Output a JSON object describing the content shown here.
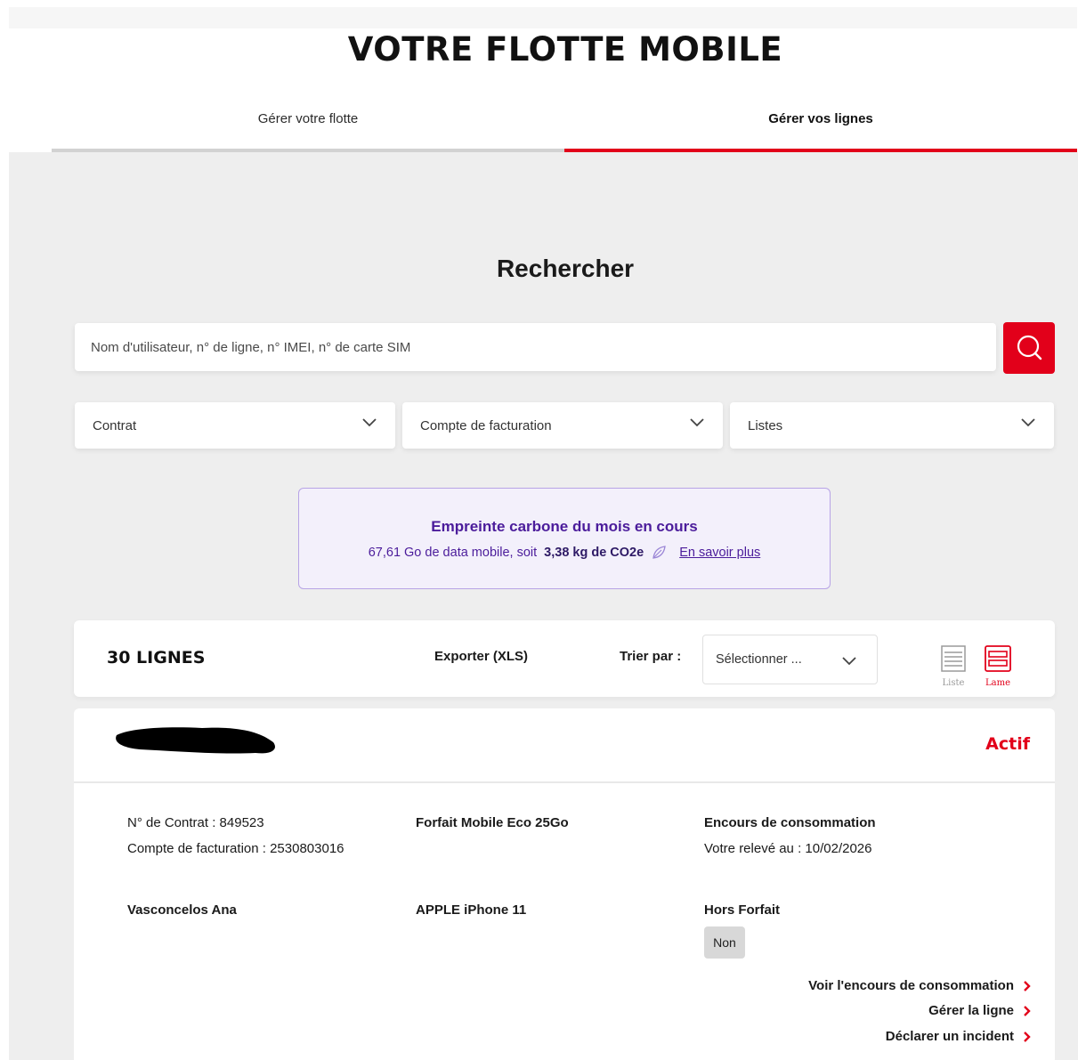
{
  "page": {
    "title": "VOTRE FLOTTE MOBILE"
  },
  "tabs": [
    {
      "label": "Gérer votre flotte",
      "active": false
    },
    {
      "label": "Gérer vos lignes",
      "active": true
    }
  ],
  "search": {
    "title": "Rechercher",
    "placeholder": "Nom d'utilisateur, n° de ligne, n° IMEI, n° de carte SIM",
    "button_icon": "search-icon"
  },
  "filters": [
    {
      "label": "Contrat"
    },
    {
      "label": "Compte de facturation"
    },
    {
      "label": "Listes"
    }
  ],
  "carbon": {
    "title": "Empreinte carbone du mois en cours",
    "text": "67,61 Go de data mobile, soit",
    "value": "3,38 kg de CO2e",
    "icon": "leaf-icon",
    "link": "En savoir plus"
  },
  "toolbar": {
    "count": "30 LIGNES",
    "export": "Exporter (XLS)",
    "sort_label": "Trier par :",
    "sort_value": "Sélectionner ...",
    "view_list": "Liste",
    "view_card": "Lame"
  },
  "line": {
    "status": "Actif",
    "contract": "N° de Contrat : 849523",
    "billing": "Compte de facturation : 2530803016",
    "plan": "Forfait Mobile Eco 25Go",
    "usage_title": "Encours de consommation",
    "statement": "Votre relevé au : 10/02/2026",
    "user": "Vasconcelos Ana",
    "device": "APPLE iPhone 11",
    "overage_title": "Hors Forfait",
    "overage_value": "Non",
    "actions": [
      "Voir l'encours de consommation",
      "Gérer la ligne",
      "Déclarer un incident"
    ]
  },
  "colors": {
    "accent": "#e2001a",
    "carbon_text": "#4b1c9b",
    "background": "#eeeeee"
  }
}
